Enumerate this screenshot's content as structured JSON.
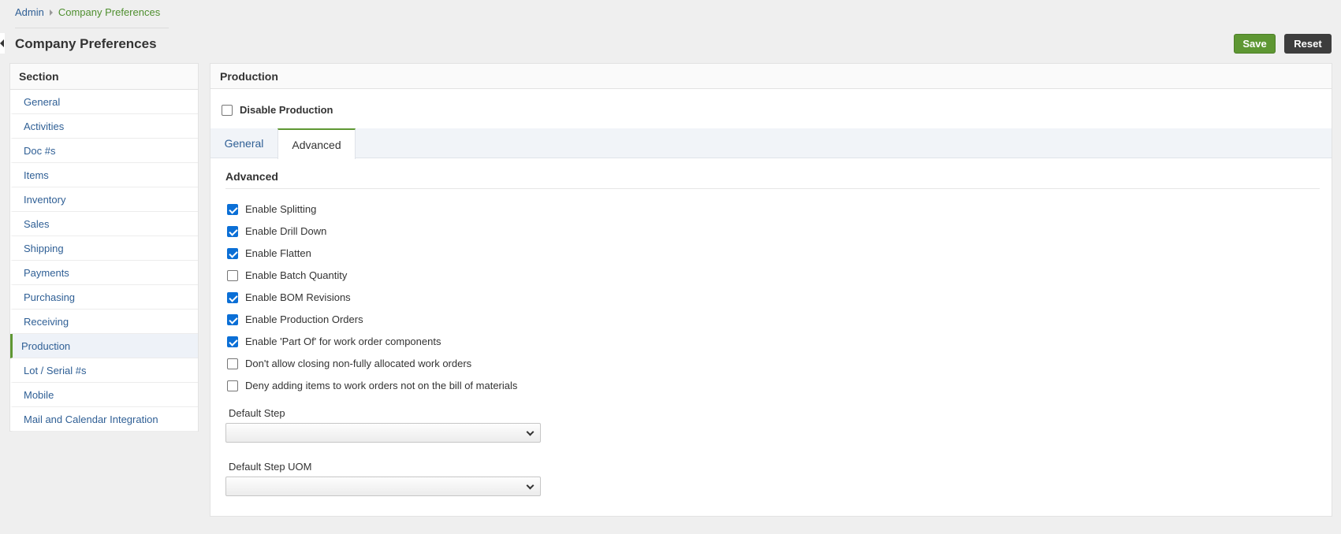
{
  "breadcrumb": {
    "root": "Admin",
    "current": "Company Preferences"
  },
  "page": {
    "title": "Company Preferences"
  },
  "toolbar": {
    "save_label": "Save",
    "reset_label": "Reset"
  },
  "sidebar": {
    "header": "Section",
    "items": [
      {
        "label": "General"
      },
      {
        "label": "Activities"
      },
      {
        "label": "Doc #s"
      },
      {
        "label": "Items"
      },
      {
        "label": "Inventory"
      },
      {
        "label": "Sales"
      },
      {
        "label": "Shipping"
      },
      {
        "label": "Payments"
      },
      {
        "label": "Purchasing"
      },
      {
        "label": "Receiving"
      },
      {
        "label": "Production",
        "active": true
      },
      {
        "label": "Lot / Serial #s"
      },
      {
        "label": "Mobile"
      },
      {
        "label": "Mail and Calendar Integration"
      }
    ]
  },
  "main": {
    "title": "Production",
    "disable_production": {
      "label": "Disable Production",
      "checked": false
    },
    "tabs": [
      {
        "label": "General",
        "active": false
      },
      {
        "label": "Advanced",
        "active": true
      }
    ],
    "advanced": {
      "title": "Advanced",
      "options": [
        {
          "label": "Enable Splitting",
          "checked": true
        },
        {
          "label": "Enable Drill Down",
          "checked": true
        },
        {
          "label": "Enable Flatten",
          "checked": true
        },
        {
          "label": "Enable Batch Quantity",
          "checked": false
        },
        {
          "label": "Enable BOM Revisions",
          "checked": true
        },
        {
          "label": "Enable Production Orders",
          "checked": true
        },
        {
          "label": "Enable 'Part Of' for work order components",
          "checked": true
        },
        {
          "label": "Don't allow closing non-fully allocated work orders",
          "checked": false
        },
        {
          "label": "Deny adding items to work orders not on the bill of materials",
          "checked": false
        }
      ],
      "default_step": {
        "label": "Default Step",
        "value": ""
      },
      "default_step_uom": {
        "label": "Default Step UOM",
        "value": ""
      }
    }
  },
  "colors": {
    "accent_green": "#5e9733",
    "link_blue": "#2f5f95",
    "checkbox_blue": "#0b6fd6",
    "reset_dark": "#3d3d3d"
  }
}
